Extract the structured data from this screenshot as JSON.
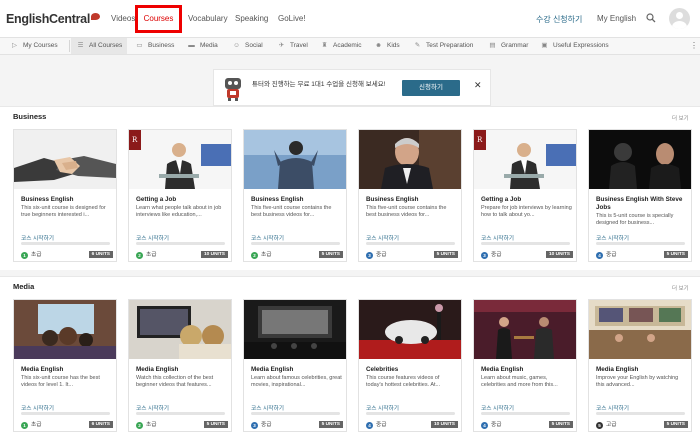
{
  "header": {
    "logo": "EnglishCentral",
    "nav": [
      "Videos",
      "Courses",
      "Vocabulary",
      "Speaking",
      "GoLive!"
    ],
    "enroll_label": "수강 신청하기",
    "my_english_label": "My English",
    "search_icon": "search-icon",
    "avatar_icon": "user-avatar-icon"
  },
  "subnav": {
    "my_courses": "My Courses",
    "all_courses": "All Courses",
    "categories": [
      "Business",
      "Media",
      "Social",
      "Travel",
      "Academic",
      "Kids",
      "Test Preparation",
      "Grammar",
      "Useful Expressions"
    ]
  },
  "banner": {
    "text": "튜터와 진행하는 무료 1대1 수업을 신청해 보세요!",
    "button": "신청하기",
    "close": "✕"
  },
  "sections": [
    {
      "title": "Business",
      "more": "더 보기",
      "cards": [
        {
          "title": "Business English",
          "desc": "This six-unit course is designed for true beginners interested i...",
          "units": "6 UNITS",
          "start": "코스 시작하기",
          "level_num": "1",
          "level_label": "초급",
          "level_color": "#3aa655"
        },
        {
          "title": "Getting a Job",
          "desc": "Learn what people talk about in job interviews like education,...",
          "units": "10 UNITS",
          "start": "코스 시작하기",
          "level_num": "2",
          "level_label": "초급",
          "level_color": "#3aa655"
        },
        {
          "title": "Business English",
          "desc": "This five-unit course contains the best business videos for...",
          "units": "5 UNITS",
          "start": "코스 시작하기",
          "level_num": "2",
          "level_label": "초급",
          "level_color": "#3aa655"
        },
        {
          "title": "Business English",
          "desc": "This five-unit course contains the best business videos for...",
          "units": "5 UNITS",
          "start": "코스 시작하기",
          "level_num": "3",
          "level_label": "중급",
          "level_color": "#2f6fb0"
        },
        {
          "title": "Getting a Job",
          "desc": "Prepare for job interviews by learning how to talk about yo...",
          "units": "10 UNITS",
          "start": "코스 시작하기",
          "level_num": "3",
          "level_label": "중급",
          "level_color": "#2f6fb0"
        },
        {
          "title": "Business English With Steve Jobs",
          "desc": "This is 5-unit course is specially designed for business...",
          "units": "5 UNITS",
          "start": "코스 시작하기",
          "level_num": "4",
          "level_label": "중급",
          "level_color": "#2f6fb0"
        }
      ]
    },
    {
      "title": "Media",
      "more": "더 보기",
      "cards": [
        {
          "title": "Media English",
          "desc": "This six-unit course has the best videos for level 1. It...",
          "units": "6 UNITS",
          "start": "코스 시작하기",
          "level_num": "1",
          "level_label": "초급",
          "level_color": "#3aa655"
        },
        {
          "title": "Media English",
          "desc": "Watch this collection of the best beginner videos that features...",
          "units": "5 UNITS",
          "start": "코스 시작하기",
          "level_num": "2",
          "level_label": "초급",
          "level_color": "#3aa655"
        },
        {
          "title": "Media English",
          "desc": "Learn about famous celebrities, great movies, inspirational...",
          "units": "5 UNITS",
          "start": "코스 시작하기",
          "level_num": "3",
          "level_label": "중급",
          "level_color": "#2f6fb0"
        },
        {
          "title": "Celebrities",
          "desc": "This course features videos of today's hottest celebrities. At...",
          "units": "10 UNITS",
          "start": "코스 시작하기",
          "level_num": "4",
          "level_label": "중급",
          "level_color": "#2f6fb0"
        },
        {
          "title": "Media English",
          "desc": "Learn about music, games, celebrities and more from this...",
          "units": "5 UNITS",
          "start": "코스 시작하기",
          "level_num": "4",
          "level_label": "중급",
          "level_color": "#2f6fb0"
        },
        {
          "title": "Media English",
          "desc": "Improve your English by watching this advanced...",
          "units": "5 UNITS",
          "start": "코스 시작하기",
          "level_num": "5",
          "level_label": "고급",
          "level_color": "#333333"
        }
      ]
    }
  ]
}
